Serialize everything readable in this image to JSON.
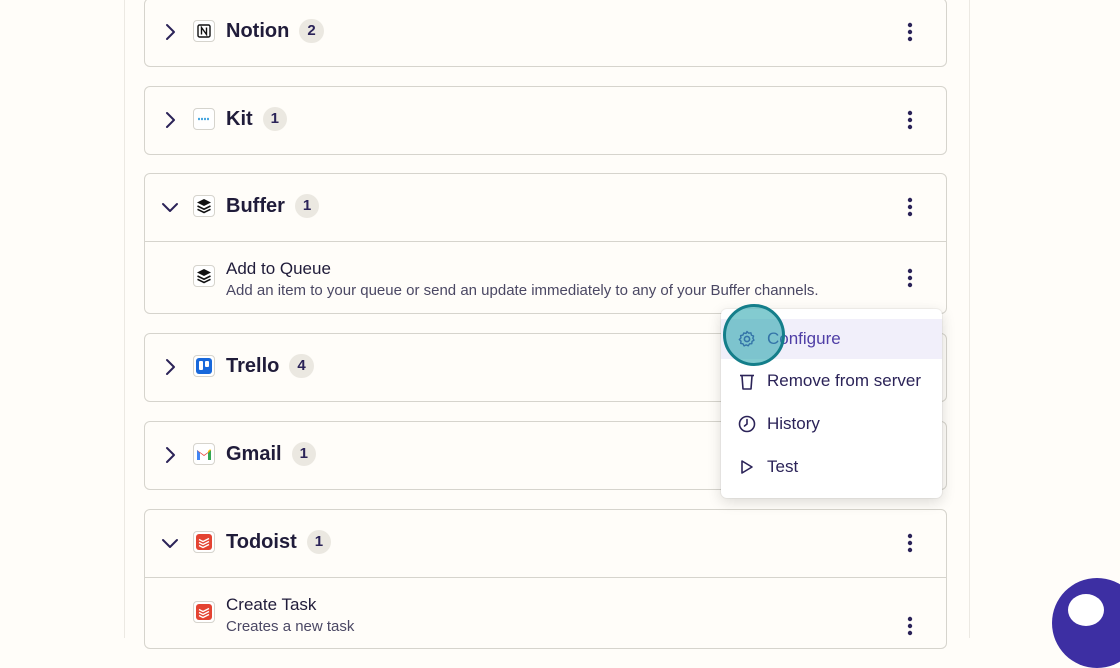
{
  "apps": [
    {
      "name": "Notion",
      "count": "2",
      "icon": "notion-icon",
      "expanded": false
    },
    {
      "name": "Kit",
      "count": "1",
      "icon": "kit-icon",
      "expanded": false
    },
    {
      "name": "Buffer",
      "count": "1",
      "icon": "buffer-icon",
      "expanded": true,
      "action": {
        "title": "Add to Queue",
        "description": "Add an item to your queue or send an update immediately to any of your Buffer channels."
      }
    },
    {
      "name": "Trello",
      "count": "4",
      "icon": "trello-icon",
      "expanded": false
    },
    {
      "name": "Gmail",
      "count": "1",
      "icon": "gmail-icon",
      "expanded": false
    },
    {
      "name": "Todoist",
      "count": "1",
      "icon": "todoist-icon",
      "expanded": true,
      "action": {
        "title": "Create Task",
        "description": "Creates a new task"
      }
    }
  ],
  "context_menu": {
    "items": [
      {
        "label": "Configure",
        "icon": "gear-icon",
        "highlighted": true
      },
      {
        "label": "Remove from server",
        "icon": "trash-icon",
        "highlighted": false
      },
      {
        "label": "History",
        "icon": "clock-icon",
        "highlighted": false
      },
      {
        "label": "Test",
        "icon": "play-icon",
        "highlighted": false
      }
    ]
  },
  "colors": {
    "background": "#fffdf9",
    "text": "#201c3a",
    "accent": "#4f3ea6",
    "badge": "#ebe8e1",
    "border": "#d6d4cd",
    "click_highlight": "#147e8a",
    "chat_bubble": "#3d2fa3"
  }
}
